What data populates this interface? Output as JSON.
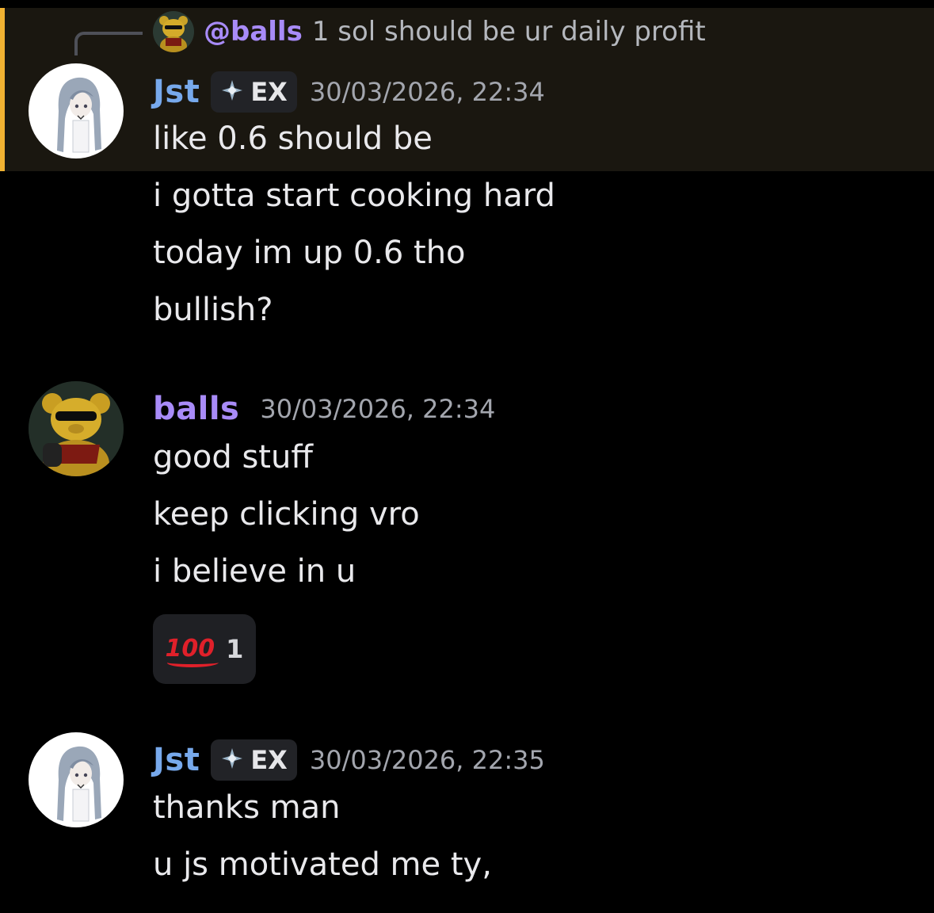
{
  "colors": {
    "background": "#000000",
    "highlight_bg": "#1a1710",
    "highlight_bar": "#f0b232",
    "jst_name": "#77a9ec",
    "balls_name": "#a88bf8",
    "timestamp": "#a3a6ae",
    "reaction_bg": "#1f2024",
    "reaction_emoji": "#e0202a"
  },
  "reply": {
    "author": "@balls",
    "text": "1 sol should be ur daily profit",
    "avatar_icon": "pooh-bear-avatar"
  },
  "messages": [
    {
      "author": "Jst",
      "tag": "EX",
      "tag_icon": "diamond-cross-icon",
      "timestamp": "30/03/2026, 22:34",
      "avatar_icon": "anime-girl-avatar",
      "lines": [
        "like 0.6 should be",
        "i gotta start cooking hard",
        "today im up 0.6 tho",
        "bullish?"
      ]
    },
    {
      "author": "balls",
      "timestamp": "30/03/2026, 22:34",
      "avatar_icon": "pooh-bear-avatar",
      "lines": [
        "good stuff",
        "keep clicking vro",
        "i believe in u"
      ],
      "reaction": {
        "emoji": "100",
        "emoji_icon": "hundred-points-icon",
        "count": "1"
      }
    },
    {
      "author": "Jst",
      "tag": "EX",
      "tag_icon": "diamond-cross-icon",
      "timestamp": "30/03/2026, 22:35",
      "avatar_icon": "anime-girl-avatar",
      "lines": [
        "thanks man",
        "u js motivated me ty,"
      ]
    }
  ]
}
